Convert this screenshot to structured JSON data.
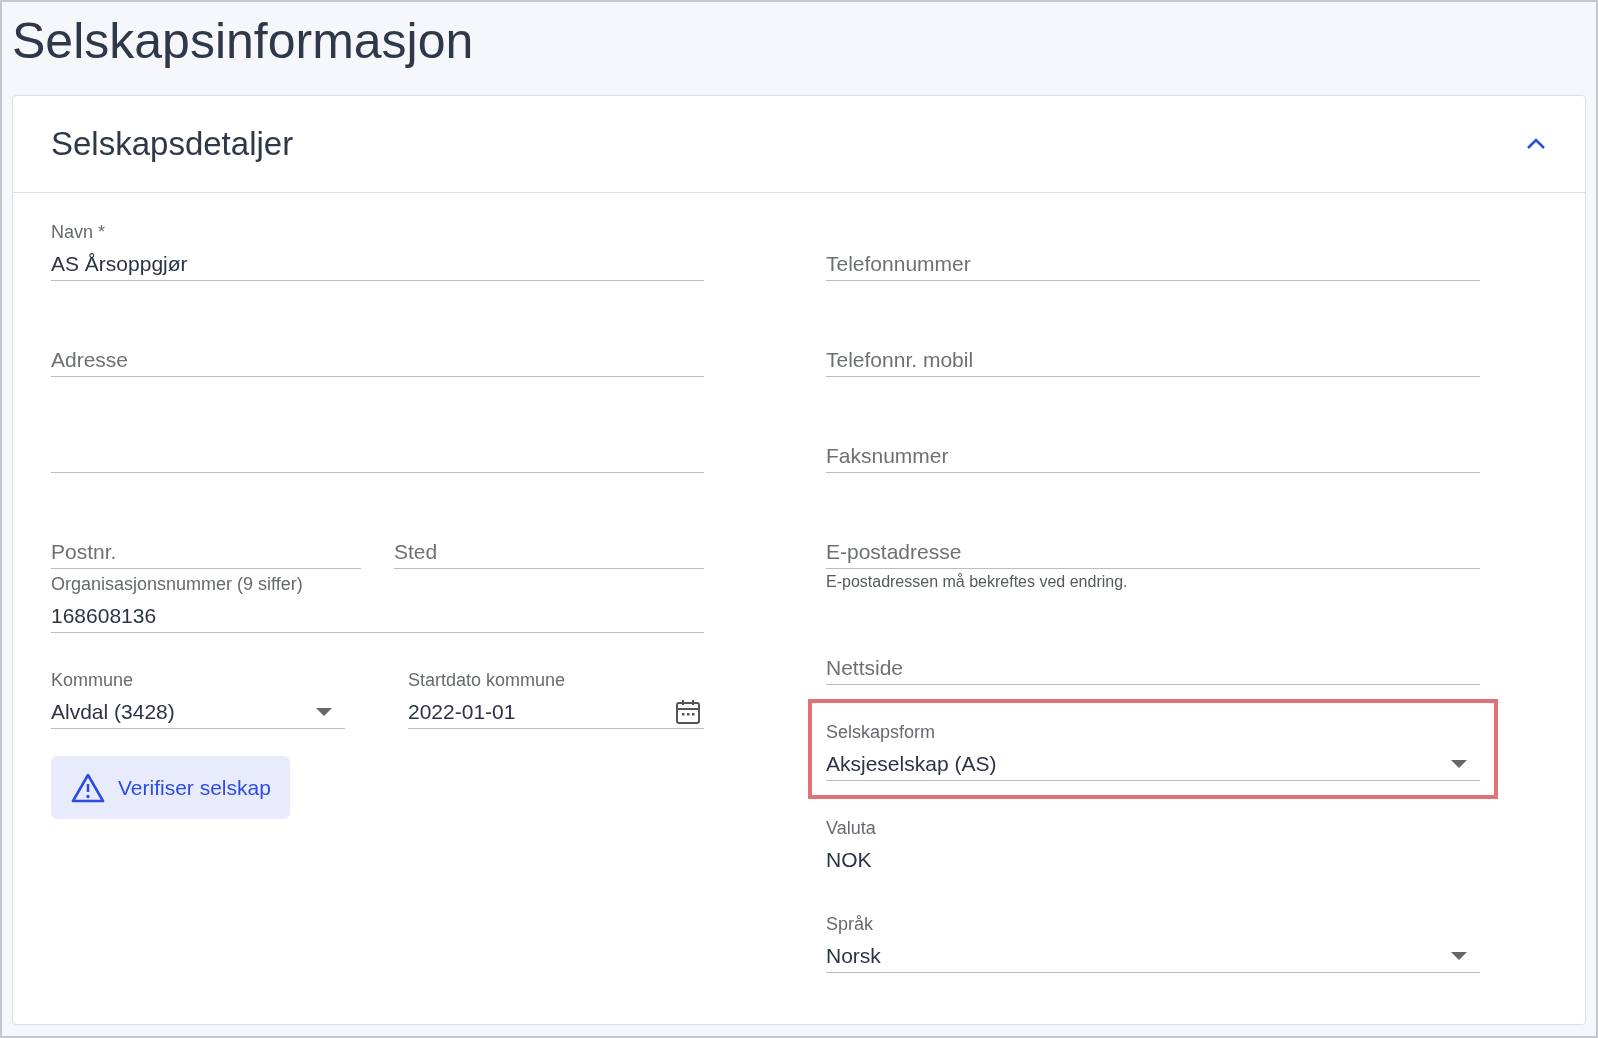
{
  "page_title": "Selskapsinformasjon",
  "card": {
    "title": "Selskapsdetaljer",
    "expanded": true
  },
  "left_fields": [
    {
      "kind": "text",
      "label": "Navn *",
      "value": "AS Årsoppgjør"
    },
    {
      "kind": "text",
      "placeholder": "Adresse"
    },
    {
      "kind": "blank"
    },
    {
      "kind": "pair",
      "fields": [
        {
          "kind": "text",
          "placeholder": "Postnr."
        },
        {
          "kind": "text",
          "placeholder": "Sted"
        }
      ]
    },
    {
      "kind": "text",
      "label": "Organisasjonsnummer (9 siffer)",
      "value": "168608136",
      "tight": true
    },
    {
      "kind": "pair",
      "fields": [
        {
          "kind": "select",
          "label": "Kommune",
          "value": "Alvdal (3428)"
        },
        {
          "kind": "date",
          "label": "Startdato kommune",
          "value": "2022-01-01"
        }
      ]
    }
  ],
  "verify_button": {
    "label": "Verifiser selskap"
  },
  "right_fields": [
    {
      "kind": "text",
      "placeholder": "Telefonnummer"
    },
    {
      "kind": "text",
      "placeholder": "Telefonnr. mobil"
    },
    {
      "kind": "text",
      "placeholder": "Faksnummer"
    },
    {
      "kind": "text",
      "placeholder": "E-postadresse",
      "hint": "E-postadressen må bekreftes ved endring."
    },
    {
      "kind": "text",
      "placeholder": "Nettside"
    },
    {
      "kind": "select",
      "label": "Selskapsform",
      "value": "Aksjeselskap (AS)",
      "highlighted": true
    },
    {
      "kind": "static",
      "label": "Valuta",
      "value": "NOK"
    },
    {
      "kind": "select",
      "label": "Språk",
      "value": "Norsk"
    }
  ]
}
